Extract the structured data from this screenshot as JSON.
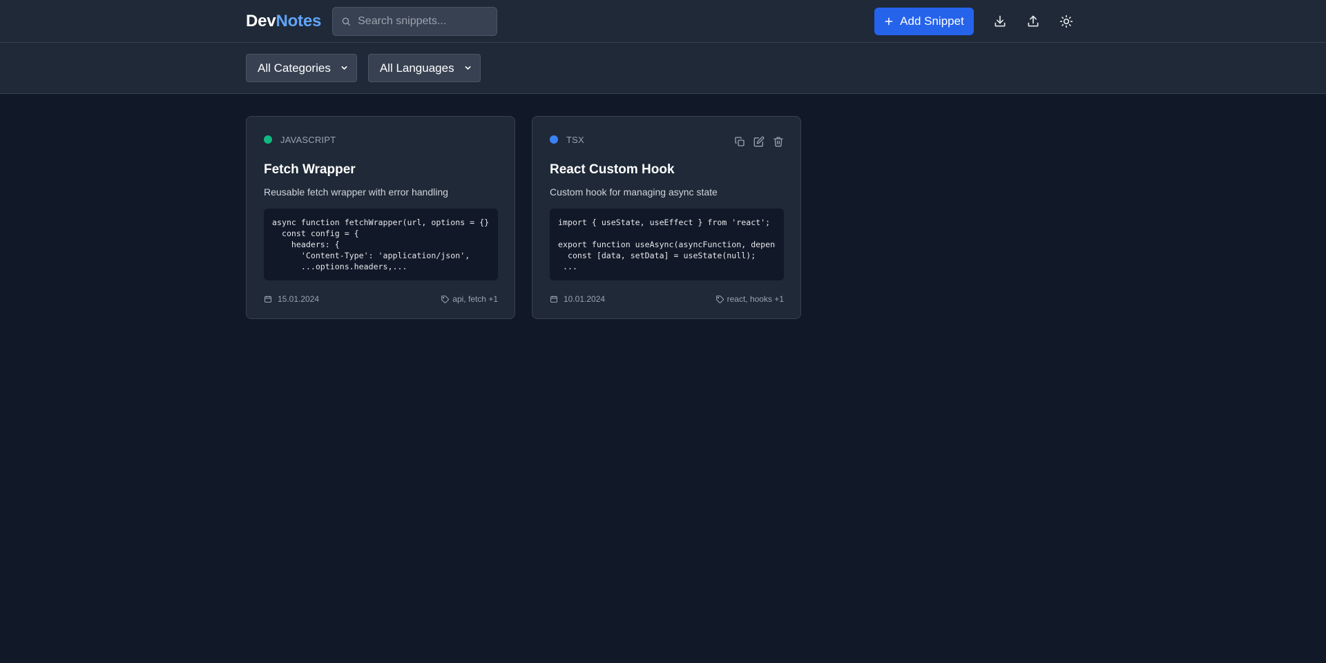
{
  "header": {
    "logo_part1": "Dev",
    "logo_part2": "Notes",
    "search_placeholder": "Search snippets...",
    "add_button_label": "Add Snippet",
    "icons": [
      "search-icon",
      "plus-icon",
      "download-icon",
      "upload-icon",
      "sun-icon"
    ]
  },
  "filters": {
    "category": {
      "selected": "All Categories"
    },
    "language": {
      "selected": "All Languages"
    }
  },
  "snippets": [
    {
      "language": "JAVASCRIPT",
      "language_color": "#10b981",
      "title": "Fetch Wrapper",
      "description": "Reusable fetch wrapper with error handling",
      "code": "async function fetchWrapper(url, options = {}) {\n  const config = {\n    headers: {\n      'Content-Type': 'application/json',\n      ...options.headers,...",
      "date": "15.01.2024",
      "tags": "api, fetch +1",
      "show_actions": false
    },
    {
      "language": "TSX",
      "language_color": "#3b82f6",
      "title": "React Custom Hook",
      "description": "Custom hook for managing async state",
      "code": "import { useState, useEffect } from 'react';\n\nexport function useAsync(asyncFunction, dependen\n  const [data, setData] = useState(null);\n ...",
      "date": "10.01.2024",
      "tags": "react, hooks +1",
      "show_actions": true
    }
  ],
  "colors": {
    "background": "#111827",
    "surface": "#1f2937",
    "accent": "#2563eb",
    "logo_accent": "#60a5fa"
  }
}
